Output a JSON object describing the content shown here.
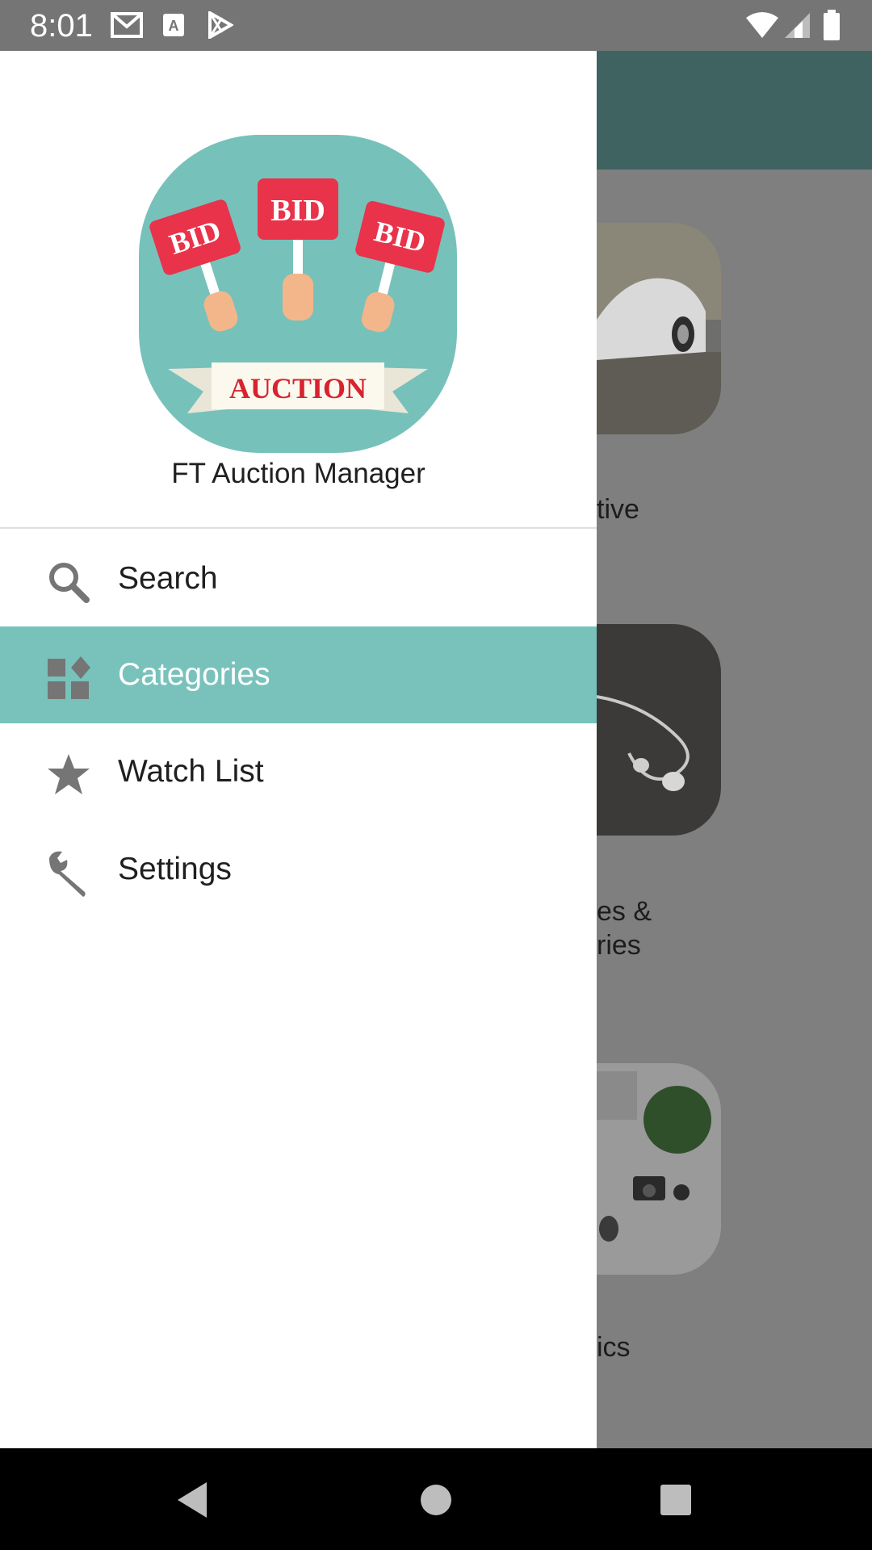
{
  "status_bar": {
    "time": "8:01",
    "icons": [
      "gmail-icon",
      "font-a-icon",
      "play-store-icon",
      "wifi-icon",
      "signal-icon",
      "battery-icon"
    ]
  },
  "drawer": {
    "logo": {
      "signs": [
        "BID",
        "BID",
        "BID"
      ],
      "banner": "AUCTION"
    },
    "app_name": "FT Auction Manager",
    "items": [
      {
        "label": "Search",
        "icon": "search-icon",
        "active": false
      },
      {
        "label": "Categories",
        "icon": "categories-icon",
        "active": true
      },
      {
        "label": "Watch List",
        "icon": "star-icon",
        "active": false
      },
      {
        "label": "Settings",
        "icon": "wrench-icon",
        "active": false
      }
    ],
    "accent_color": "#79c2bc"
  },
  "background": {
    "toolbar_color": "#3f6360",
    "card_labels": [
      "tive",
      "es &",
      "ries",
      "ics"
    ]
  },
  "nav_bar": {
    "icons": [
      "back-icon",
      "home-icon",
      "recents-icon"
    ]
  }
}
